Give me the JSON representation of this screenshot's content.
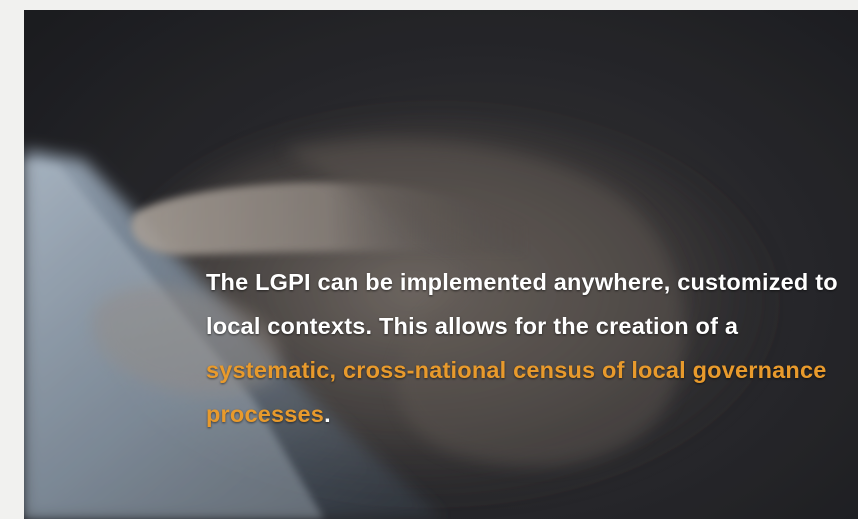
{
  "hero": {
    "image_description_icon": "hand-holding-phone-image",
    "caption": {
      "part1": "The LGPI can be implemented anywhere, customized to local contexts. This allows for the creation of a ",
      "highlight": "systematic, cross-national census of local governance processes",
      "part2": "."
    }
  },
  "colors": {
    "background": "#f1f1ef",
    "text": "#ffffff",
    "highlight": "#e89a2c"
  }
}
